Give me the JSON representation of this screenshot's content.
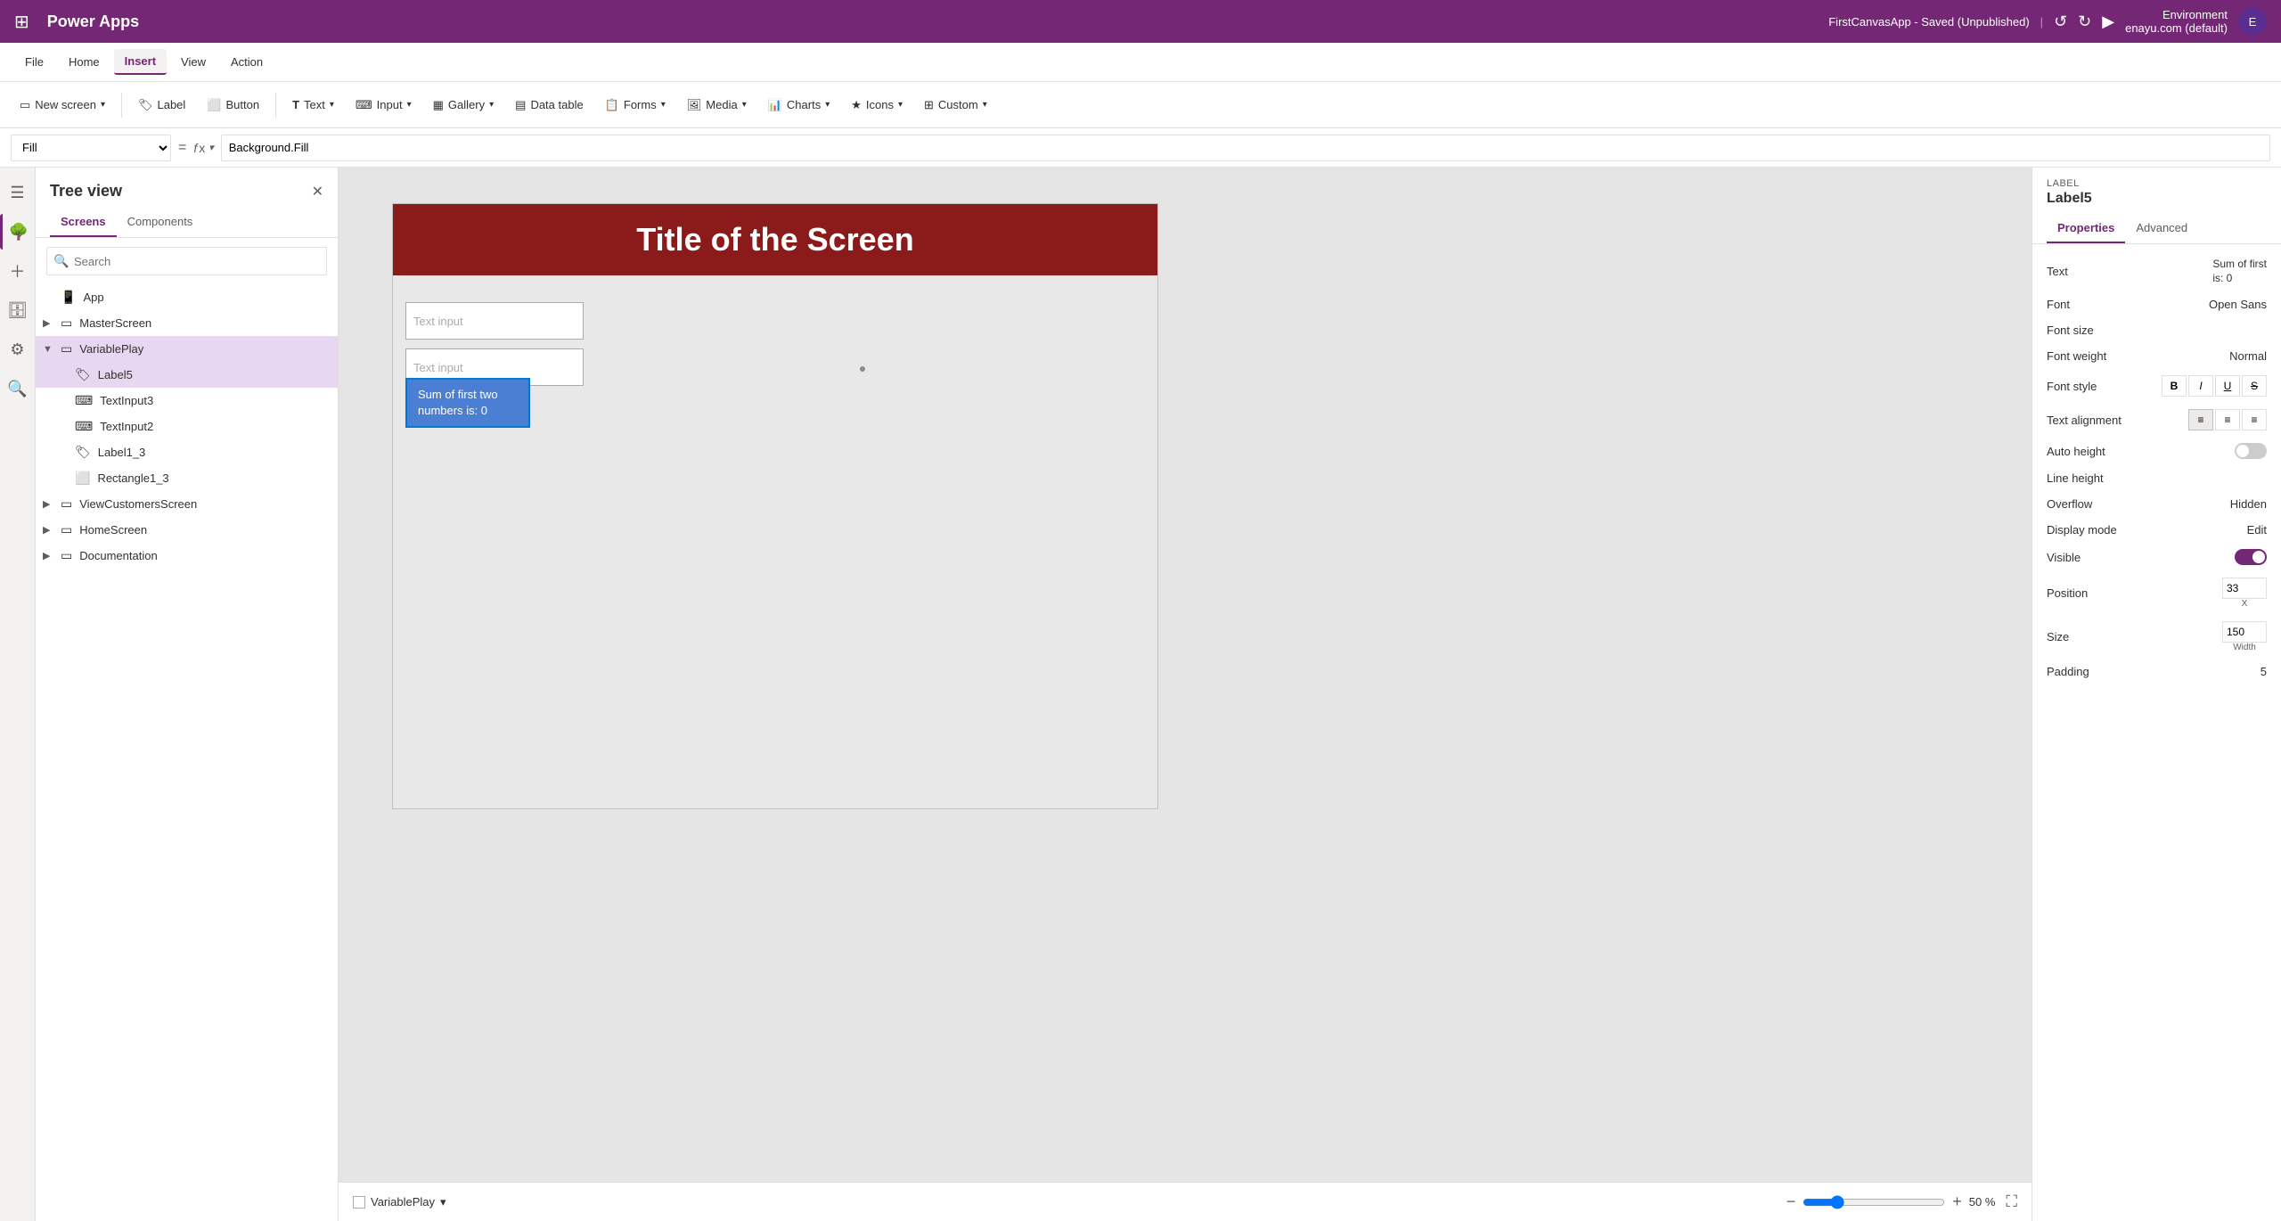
{
  "app": {
    "title": "Power Apps",
    "environment_label": "Environment",
    "environment_name": "enayu.com (default)"
  },
  "menu": {
    "items": [
      "File",
      "Home",
      "Insert",
      "View",
      "Action"
    ],
    "active": "Insert",
    "save_status": "FirstCanvasApp - Saved (Unpublished)"
  },
  "toolbar": {
    "buttons": [
      {
        "label": "New screen",
        "icon": "▭",
        "has_dropdown": true
      },
      {
        "label": "Label",
        "icon": "🏷",
        "has_dropdown": false
      },
      {
        "label": "Button",
        "icon": "⬜",
        "has_dropdown": false
      },
      {
        "label": "Text",
        "icon": "T",
        "has_dropdown": true
      },
      {
        "label": "Input",
        "icon": "⌨",
        "has_dropdown": true
      },
      {
        "label": "Gallery",
        "icon": "▦",
        "has_dropdown": true
      },
      {
        "label": "Data table",
        "icon": "▤",
        "has_dropdown": false
      },
      {
        "label": "Forms",
        "icon": "📋",
        "has_dropdown": true
      },
      {
        "label": "Media",
        "icon": "🖼",
        "has_dropdown": true
      },
      {
        "label": "Charts",
        "icon": "📊",
        "has_dropdown": true
      },
      {
        "label": "Icons",
        "icon": "★",
        "has_dropdown": true
      },
      {
        "label": "Custom",
        "icon": "⊞",
        "has_dropdown": true
      }
    ]
  },
  "formula_bar": {
    "property": "Fill",
    "formula": "Background.Fill"
  },
  "sidebar": {
    "title": "Tree view",
    "tabs": [
      "Screens",
      "Components"
    ],
    "active_tab": "Screens",
    "search_placeholder": "Search",
    "items": [
      {
        "id": "App",
        "label": "App",
        "icon": "app",
        "level": 0,
        "expandable": false
      },
      {
        "id": "MasterScreen",
        "label": "MasterScreen",
        "icon": "screen",
        "level": 0,
        "expandable": true,
        "expanded": false
      },
      {
        "id": "VariablePlay",
        "label": "VariablePlay",
        "icon": "screen",
        "level": 0,
        "expandable": true,
        "expanded": true,
        "selected": true
      },
      {
        "id": "Label5",
        "label": "Label5",
        "icon": "label",
        "level": 1,
        "expandable": false,
        "selected": true
      },
      {
        "id": "TextInput3",
        "label": "TextInput3",
        "icon": "input",
        "level": 1,
        "expandable": false
      },
      {
        "id": "TextInput2",
        "label": "TextInput2",
        "icon": "input",
        "level": 1,
        "expandable": false
      },
      {
        "id": "Label1_3",
        "label": "Label1_3",
        "icon": "label",
        "level": 1,
        "expandable": false
      },
      {
        "id": "Rectangle1_3",
        "label": "Rectangle1_3",
        "icon": "rect",
        "level": 1,
        "expandable": false
      },
      {
        "id": "ViewCustomersScreen",
        "label": "ViewCustomersScreen",
        "icon": "screen",
        "level": 0,
        "expandable": true,
        "expanded": false
      },
      {
        "id": "HomeScreen",
        "label": "HomeScreen",
        "icon": "screen",
        "level": 0,
        "expandable": true,
        "expanded": false
      },
      {
        "id": "Documentation",
        "label": "Documentation",
        "icon": "screen",
        "level": 0,
        "expandable": true,
        "expanded": false
      }
    ]
  },
  "canvas": {
    "screen_name": "VariablePlay",
    "title_text": "Title of the Screen",
    "title_bg_color": "#8b1a1a",
    "title_text_color": "#ffffff",
    "text_input1_placeholder": "Text input",
    "text_input2_placeholder": "Text input",
    "label_text": "Sum of first two numbers is: 0",
    "zoom_level": "50 %",
    "bg_color": "#e8e8e8"
  },
  "right_panel": {
    "label": "LABEL",
    "element_name": "Label5",
    "tabs": [
      "Properties",
      "Advanced"
    ],
    "active_tab": "Properties",
    "props": [
      {
        "key": "Text",
        "value": "Sum of first\nis: 0",
        "type": "text"
      },
      {
        "key": "Font",
        "value": "Open Sans",
        "type": "text"
      },
      {
        "key": "Font size",
        "value": "",
        "type": "text"
      },
      {
        "key": "Font weight",
        "value": "Normal",
        "type": "text"
      },
      {
        "key": "Font style",
        "value": "/ /",
        "type": "text"
      },
      {
        "key": "Text alignment",
        "value": "align",
        "type": "align"
      },
      {
        "key": "Auto height",
        "value": "",
        "type": "toggle"
      },
      {
        "key": "Line height",
        "value": "",
        "type": "text"
      },
      {
        "key": "Overflow",
        "value": "Hidden",
        "type": "text"
      },
      {
        "key": "Display mode",
        "value": "Edit",
        "type": "text"
      },
      {
        "key": "Visible",
        "value": "",
        "type": "toggle"
      },
      {
        "key": "Position",
        "value": "33",
        "type": "position"
      },
      {
        "key": "Size",
        "value": "150",
        "type": "size"
      },
      {
        "key": "Padding",
        "value": "5",
        "type": "text"
      }
    ]
  }
}
